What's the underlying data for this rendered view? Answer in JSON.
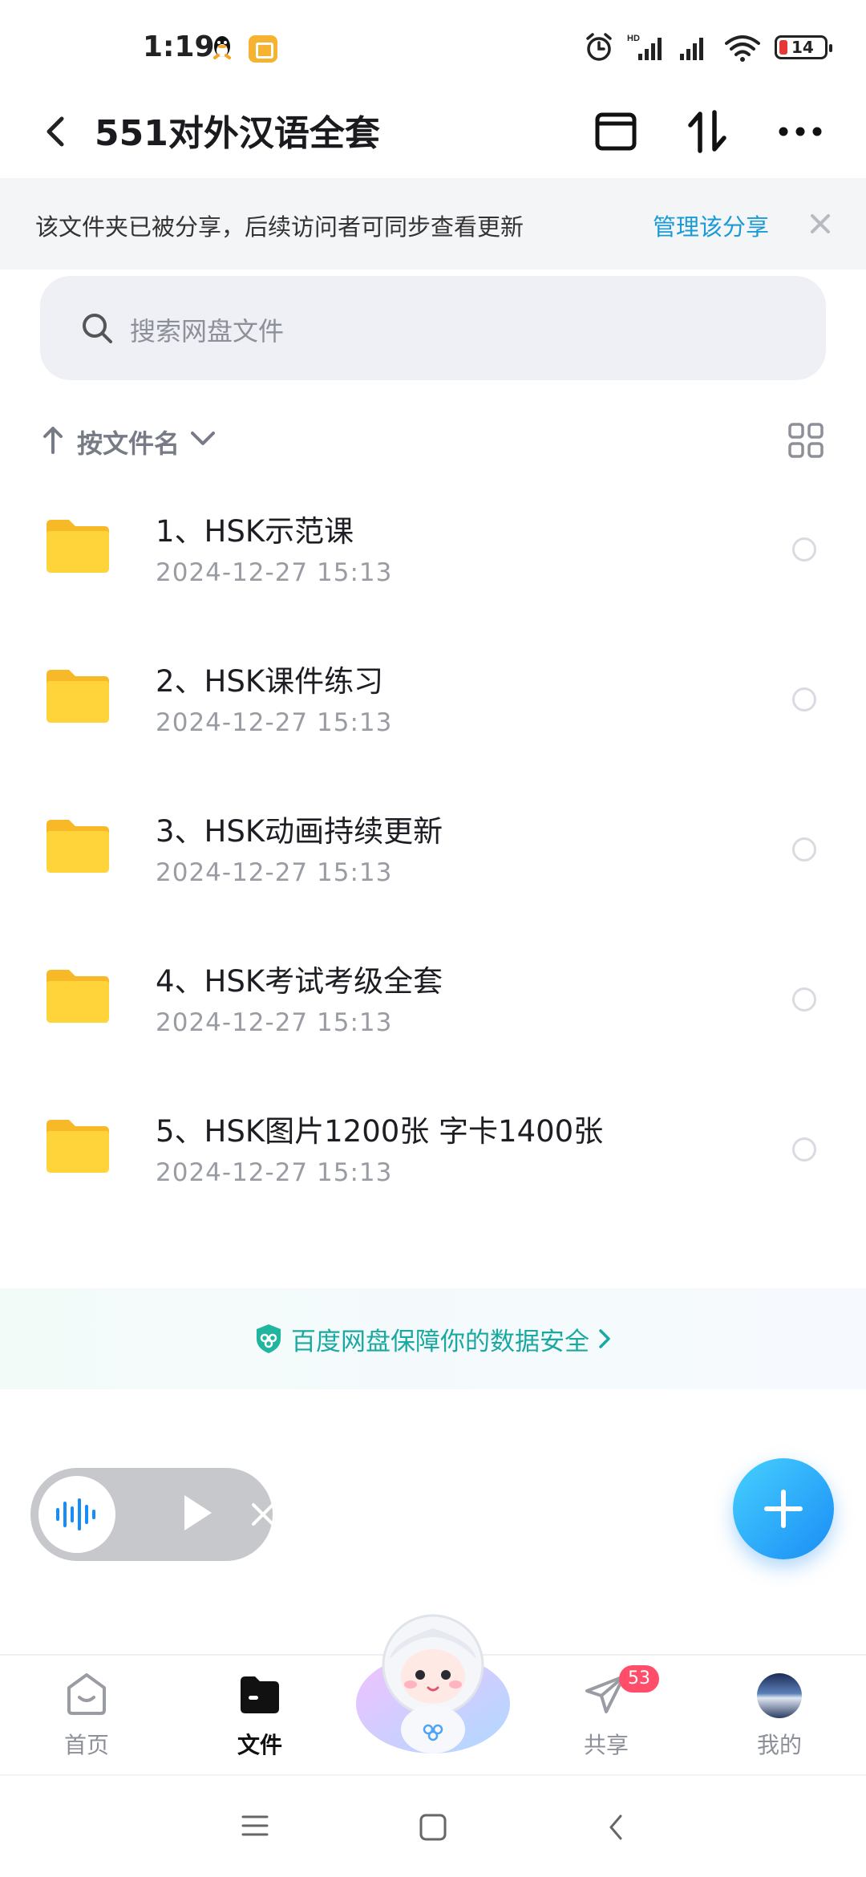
{
  "status_bar": {
    "time": "1:19",
    "battery": "14"
  },
  "header": {
    "title": "551对外汉语全套"
  },
  "share_banner": {
    "text": "该文件夹已被分享，后续访问者可同步查看更新",
    "manage_link": "管理该分享"
  },
  "search": {
    "placeholder": "搜索网盘文件"
  },
  "sort": {
    "label": "按文件名"
  },
  "files": [
    {
      "name": "1、HSK示范课",
      "date": "2024-12-27  15:13"
    },
    {
      "name": "2、HSK课件练习",
      "date": "2024-12-27  15:13"
    },
    {
      "name": "3、HSK动画持续更新",
      "date": "2024-12-27  15:13"
    },
    {
      "name": "4、HSK考试考级全套",
      "date": "2024-12-27  15:13"
    },
    {
      "name": "5、HSK图片1200张 字卡1400张",
      "date": "2024-12-27  15:13"
    }
  ],
  "safety_banner": {
    "text": "百度网盘保障你的数据安全"
  },
  "bottom_nav": {
    "home": "首页",
    "files": "文件",
    "share": "共享",
    "share_badge": "53",
    "mine": "我的"
  },
  "colors": {
    "accent": "#1a9bd7",
    "badge": "#ff4d6a",
    "folder": "#ffc933",
    "safety": "#1aa9a0"
  }
}
